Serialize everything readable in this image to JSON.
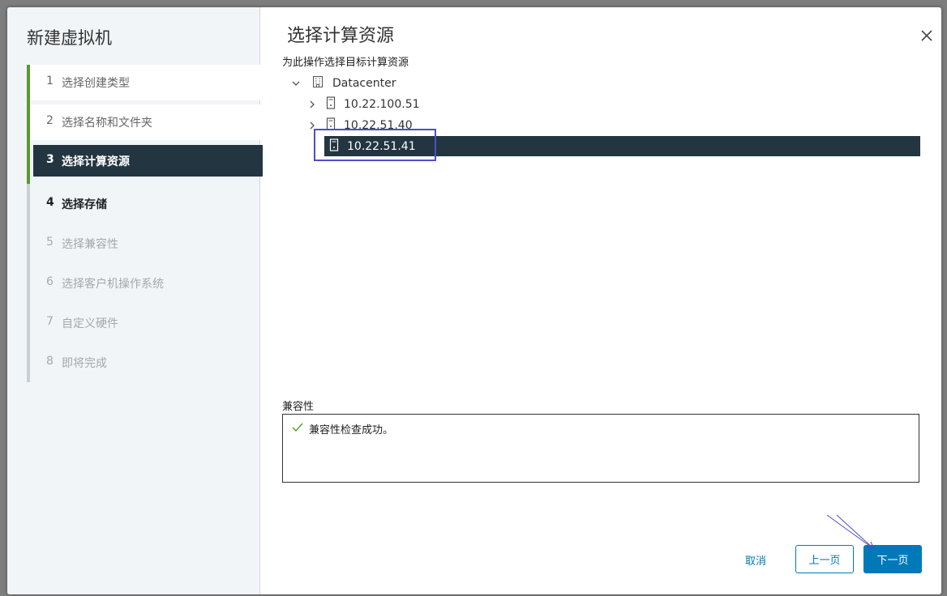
{
  "wizard": {
    "title": "新建虚拟机",
    "steps": [
      {
        "num": "1",
        "label": "选择创建类型"
      },
      {
        "num": "2",
        "label": "选择名称和文件夹"
      },
      {
        "num": "3",
        "label": "选择计算资源"
      },
      {
        "num": "4",
        "label": "选择存储"
      },
      {
        "num": "5",
        "label": "选择兼容性"
      },
      {
        "num": "6",
        "label": "选择客户机操作系统"
      },
      {
        "num": "7",
        "label": "自定义硬件"
      },
      {
        "num": "8",
        "label": "即将完成"
      }
    ]
  },
  "page": {
    "title": "选择计算资源",
    "subtitle": "为此操作选择目标计算资源",
    "tree": {
      "datacenter": {
        "label": "Datacenter",
        "icon": "datacenter-icon"
      },
      "hosts": [
        {
          "label": "10.22.100.51",
          "icon": "host-icon"
        },
        {
          "label": "10.22.51.40",
          "icon": "host-icon"
        },
        {
          "label": "10.22.51.41",
          "icon": "host-icon",
          "selected": true
        }
      ]
    },
    "compatibility": {
      "label": "兼容性",
      "message": "兼容性检查成功。"
    }
  },
  "buttons": {
    "cancel": "取消",
    "back": "上一页",
    "next": "下一页"
  },
  "colors": {
    "accent": "#0079b8",
    "selected_bg": "#233540",
    "progress": "#5b9a2c",
    "annotation": "#4d4fc4"
  }
}
